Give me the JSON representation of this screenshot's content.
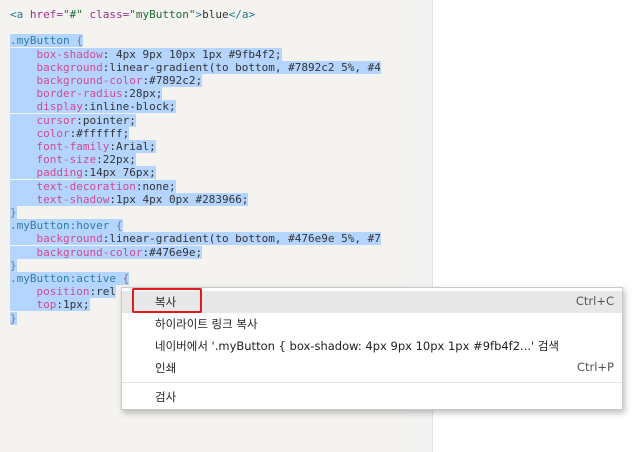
{
  "code": {
    "lines": [
      [
        {
          "t": "<a ",
          "c": "c-tag"
        },
        {
          "t": "href=",
          "c": "c-attr"
        },
        {
          "t": "\"#\"",
          "c": "c-str"
        },
        {
          "t": " class=",
          "c": "c-attr"
        },
        {
          "t": "\"myButton\"",
          "c": "c-str"
        },
        {
          "t": ">",
          "c": "c-tag"
        },
        {
          "t": "blue",
          "c": "c-plain"
        },
        {
          "t": "</a>",
          "c": "c-tag"
        }
      ],
      [],
      [
        {
          "t": ".myButton",
          "c": "c-sel"
        },
        {
          "t": " {",
          "c": "c-brace"
        }
      ],
      [
        {
          "t": "    "
        },
        {
          "t": "box-shadow",
          "c": "c-prop"
        },
        {
          "t": ": 4px 9px 10px 1px #9fb4f2;",
          "c": "c-val"
        }
      ],
      [
        {
          "t": "    "
        },
        {
          "t": "background",
          "c": "c-prop"
        },
        {
          "t": ":linear-gradient(to bottom, #7892c2 5%, #4",
          "c": "c-val"
        }
      ],
      [
        {
          "t": "    "
        },
        {
          "t": "background-color",
          "c": "c-prop"
        },
        {
          "t": ":#7892c2;",
          "c": "c-val"
        }
      ],
      [
        {
          "t": "    "
        },
        {
          "t": "border-radius",
          "c": "c-prop"
        },
        {
          "t": ":28px;",
          "c": "c-val"
        }
      ],
      [
        {
          "t": "    "
        },
        {
          "t": "display",
          "c": "c-prop"
        },
        {
          "t": ":inline-block;",
          "c": "c-val"
        }
      ],
      [
        {
          "t": "    "
        },
        {
          "t": "cursor",
          "c": "c-prop"
        },
        {
          "t": ":pointer;",
          "c": "c-val"
        }
      ],
      [
        {
          "t": "    "
        },
        {
          "t": "color",
          "c": "c-prop"
        },
        {
          "t": ":#ffffff;",
          "c": "c-val"
        }
      ],
      [
        {
          "t": "    "
        },
        {
          "t": "font-family",
          "c": "c-prop"
        },
        {
          "t": ":Arial;",
          "c": "c-val"
        }
      ],
      [
        {
          "t": "    "
        },
        {
          "t": "font-size",
          "c": "c-prop"
        },
        {
          "t": ":22px;",
          "c": "c-val"
        }
      ],
      [
        {
          "t": "    "
        },
        {
          "t": "padding",
          "c": "c-prop"
        },
        {
          "t": ":14px 76px;",
          "c": "c-val"
        }
      ],
      [
        {
          "t": "    "
        },
        {
          "t": "text-decoration",
          "c": "c-prop"
        },
        {
          "t": ":none;",
          "c": "c-val"
        }
      ],
      [
        {
          "t": "    "
        },
        {
          "t": "text-shadow",
          "c": "c-prop"
        },
        {
          "t": ":1px 4px 0px #283966;",
          "c": "c-val"
        }
      ],
      [
        {
          "t": "}",
          "c": "c-brace"
        }
      ],
      [
        {
          "t": ".myButton:hover",
          "c": "c-sel"
        },
        {
          "t": " {",
          "c": "c-brace"
        }
      ],
      [
        {
          "t": "    "
        },
        {
          "t": "background",
          "c": "c-prop"
        },
        {
          "t": ":linear-gradient(to bottom, #476e9e 5%, #7",
          "c": "c-val"
        }
      ],
      [
        {
          "t": "    "
        },
        {
          "t": "background-color",
          "c": "c-prop"
        },
        {
          "t": ":#476e9e;",
          "c": "c-val"
        }
      ],
      [
        {
          "t": "}",
          "c": "c-brace"
        }
      ],
      [
        {
          "t": ".myButton:active",
          "c": "c-sel"
        },
        {
          "t": " {",
          "c": "c-brace"
        }
      ],
      [
        {
          "t": "    "
        },
        {
          "t": "position",
          "c": "c-prop"
        },
        {
          "t": ":rel",
          "c": "c-val"
        }
      ],
      [
        {
          "t": "    "
        },
        {
          "t": "top",
          "c": "c-prop"
        },
        {
          "t": ":1px;",
          "c": "c-val"
        }
      ],
      [
        {
          "t": "}",
          "c": "c-brace"
        }
      ]
    ],
    "selected_from_line": 2
  },
  "context_menu": {
    "items": [
      {
        "label": "복사",
        "shortcut": "Ctrl+C",
        "hovered": true
      },
      {
        "label": "하이라이트 링크 복사",
        "shortcut": ""
      },
      {
        "label": "네이버에서 '.myButton {  box-shadow: 4px 9px 10px 1px #9fb4f2...' 검색",
        "shortcut": ""
      },
      {
        "label": "인쇄",
        "shortcut": "Ctrl+P"
      },
      {
        "label": "검사",
        "shortcut": ""
      }
    ]
  },
  "colors": {
    "selection": "#b4d5ff",
    "highlight_box": "#e01b1b"
  }
}
